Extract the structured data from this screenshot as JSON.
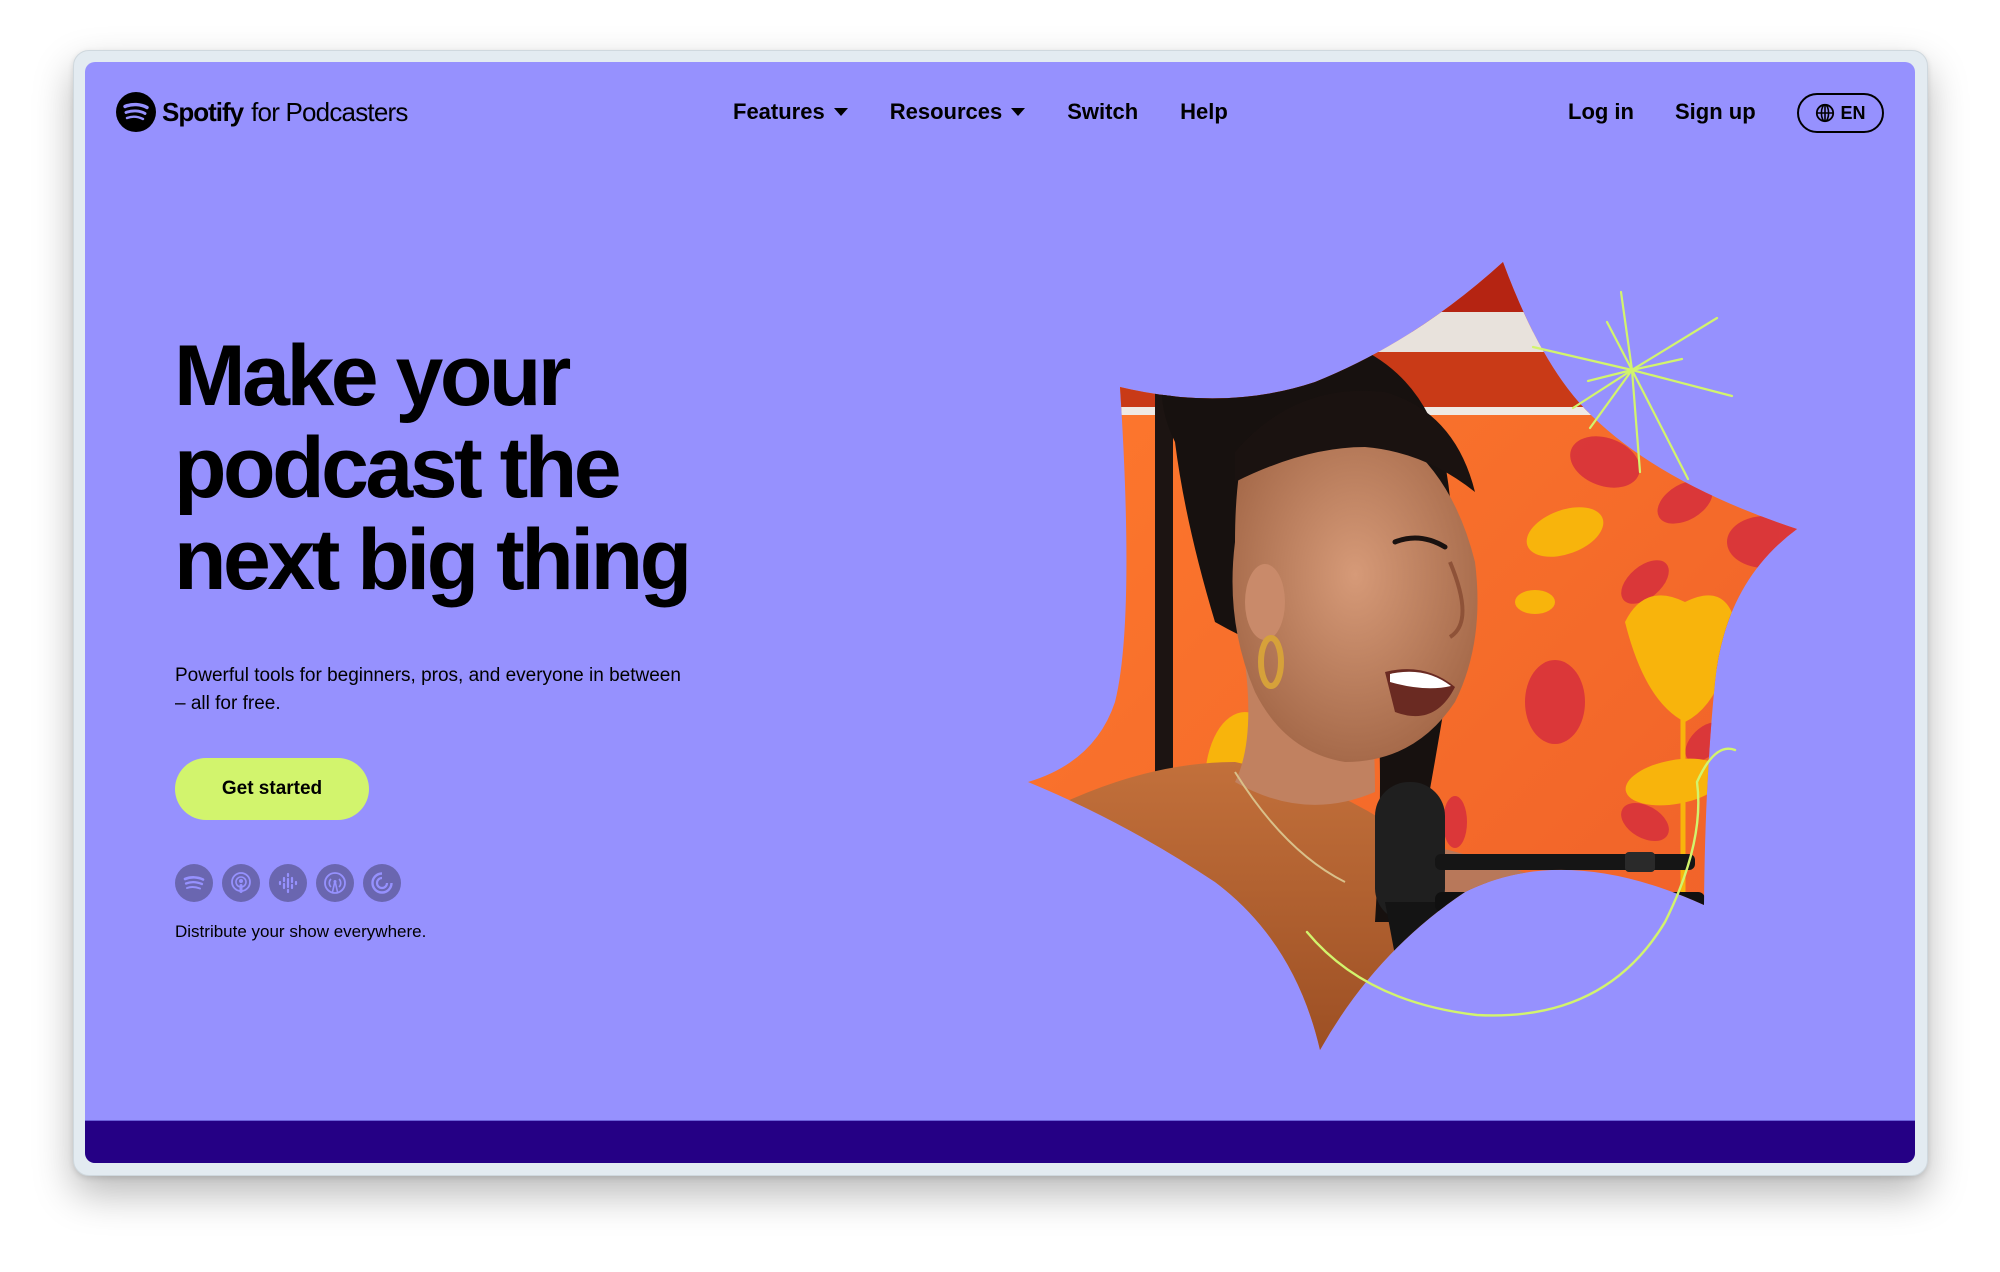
{
  "brand": {
    "name": "Spotify",
    "suffix": "for Podcasters"
  },
  "nav": {
    "items": [
      {
        "label": "Features",
        "has_dropdown": true
      },
      {
        "label": "Resources",
        "has_dropdown": true
      },
      {
        "label": "Switch",
        "has_dropdown": false
      },
      {
        "label": "Help",
        "has_dropdown": false
      }
    ],
    "login_label": "Log in",
    "signup_label": "Sign up",
    "language_label": "EN",
    "language_icon": "globe-icon"
  },
  "hero": {
    "headline_lines": [
      "Make your",
      "podcast the",
      "next big thing"
    ],
    "subtext": "Powerful tools for beginners, pros, and everyone in between – all for free.",
    "cta_label": "Get started",
    "platforms": [
      {
        "name": "Spotify",
        "icon": "spotify-icon"
      },
      {
        "name": "Apple Podcasts",
        "icon": "apple-podcasts-icon"
      },
      {
        "name": "Google Podcasts",
        "icon": "google-podcasts-icon"
      },
      {
        "name": "Overcast",
        "icon": "overcast-icon"
      },
      {
        "name": "Pocket Casts",
        "icon": "pocket-casts-icon"
      }
    ],
    "distribute_text": "Distribute your show everywhere.",
    "image_description": "Smiling woman speaking into a podcast microphone in front of an orange floral backdrop, cropped into a star shape"
  },
  "colors": {
    "background": "#9691fe",
    "accent": "#d2f46d",
    "footer_bar": "#250085",
    "platform_icon_bg": "#6a66b0",
    "text": "#000000"
  }
}
